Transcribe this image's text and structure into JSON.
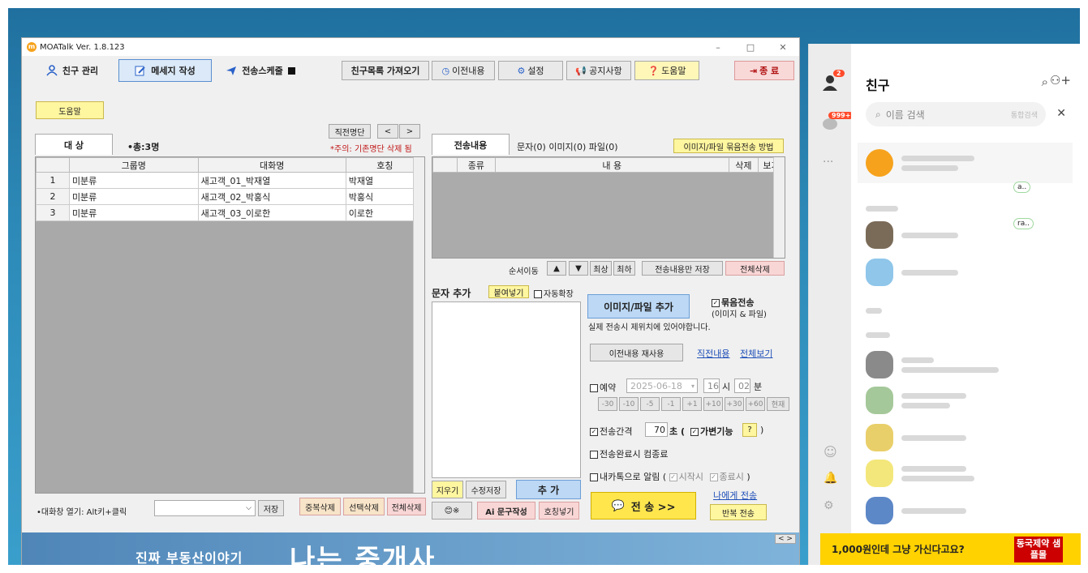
{
  "window": {
    "title": "MOATalk Ver. 1.8.123",
    "minimize": "–",
    "maximize": "□",
    "close": "✕"
  },
  "toolbar": {
    "friends": "친구 관리",
    "compose": "메세지 작성",
    "schedule": "전송스케줄",
    "fetch_friends": "친구목록 가져오기",
    "history": "이전내용",
    "settings": "설정",
    "notice": "공지사항",
    "help": "도움말",
    "exit": "종 료"
  },
  "left": {
    "help_btn": "도움말",
    "recent_list_btn": "직전명단",
    "prev": "<",
    "next": ">",
    "warning": "*주의: 기존명단 삭제 됨",
    "tab_target": "대 상",
    "total": "•총:3명",
    "columns": [
      "그룹명",
      "대화명",
      "호칭"
    ],
    "rows": [
      {
        "num": "1",
        "group": "미분류",
        "name": "새고객_01_박재열",
        "title": "박재열"
      },
      {
        "num": "2",
        "group": "미분류",
        "name": "새고객_02_박홍식",
        "title": "박홍식"
      },
      {
        "num": "3",
        "group": "미분류",
        "name": "새고객_03_이로한",
        "title": "이로한"
      }
    ],
    "open_chat_hint": "•대화창 열기: Alt키+클릭",
    "save_btn": "저장",
    "dup_delete": "중복삭제",
    "sel_delete": "선택삭제",
    "all_delete": "전체삭제"
  },
  "content": {
    "tab_send": "전송내용",
    "tab_counts": "문자(0) 이미지(0) 파일(0)",
    "bulk_method": "이미지/파일 묶음전송 방법",
    "col_type": "종류",
    "col_content": "내 용",
    "col_delete": "삭제",
    "col_view": "보기",
    "reorder": "순서이동",
    "up": "▲",
    "down": "▼",
    "top": "최상",
    "bottom": "최하",
    "save_only": "전송내용만 저장",
    "delete_all": "전체삭제"
  },
  "compose": {
    "label": "문자 추가",
    "paste_btn": "붙여넣기",
    "auto_expand": "자동확장",
    "clear_btn": "지우기",
    "edit_save_btn": "수정저장",
    "add_btn": "추 가",
    "emoji_btn": "😊※",
    "ai_btn": "Ai 문구작성",
    "honorific_btn": "호칭넣기"
  },
  "options": {
    "add_image_file": "이미지/파일 추가",
    "bundle_label": "묶음전송",
    "bundle_sub": "(이미지 & 파일)",
    "location_note": "실제 전송시 제위치에 있어야합니다.",
    "reuse_prev": "이전내용 재사용",
    "recent_content": "직전내용",
    "view_all": "전체보기",
    "reserve": "예약",
    "date": "2025-06-18",
    "hour": "16",
    "hour_unit": "시",
    "minute": "02",
    "minute_unit": "분",
    "offsets": [
      "-30",
      "-10",
      "-5",
      "-1",
      "+1",
      "+10",
      "+30",
      "+60",
      "현재"
    ],
    "interval_label": "전송간격",
    "interval_value": "70",
    "interval_unit": "초 (",
    "variable": "가변기능",
    "question": "?",
    "close_paren": ")",
    "shutdown": "전송완료시 컴종료",
    "notify_me": "내카톡으로 알림 (",
    "notify_start": "시작시",
    "notify_end": "종료시",
    "notify_close": ")",
    "send_btn": "전 송 >>",
    "send_to_me": "나에게 전송",
    "repeat_send": "반복 전송"
  },
  "banner": {
    "left_text": "진짜 부동산이야기",
    "big_text": "나는 중개사",
    "nav": "< >"
  },
  "kakao": {
    "title": "친구",
    "search_placeholder": "이름 검색",
    "search_hint": "통합검색",
    "badge_friends": "2",
    "badge_chats": "999+",
    "ad_text": "1,000원인데 그냥 가신다고요?",
    "ad_brand": "동국제약 샘플몰",
    "tag1": "a..",
    "tag2": "ra.."
  },
  "colors": {
    "active_tab": "#dbe9f8",
    "help_yellow": "#fff6a0",
    "send_gold": "#ffe64d",
    "kakao_yellow": "#ffd200",
    "warn_red": "#c01515"
  }
}
